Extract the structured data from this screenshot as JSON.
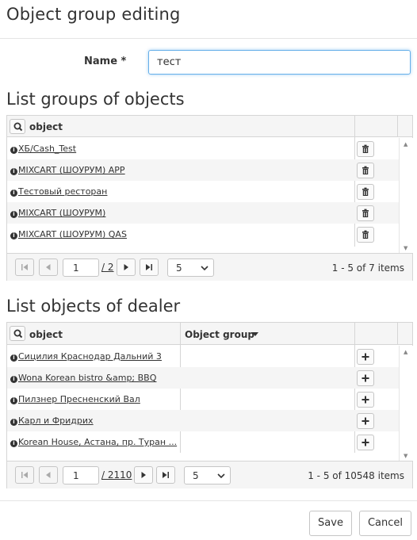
{
  "dialog": {
    "title": "Object group editing",
    "name_label": "Name *",
    "name_value": "тест"
  },
  "groups_list": {
    "title": "List groups of objects",
    "column_object": "object",
    "rows": [
      {
        "name": "ХБ/Cash_Test"
      },
      {
        "name": "MIXCART (ШОУРУМ) APP"
      },
      {
        "name": "Тестовый ресторан"
      },
      {
        "name": "MIXCART (ШОУРУМ)"
      },
      {
        "name": "MIXCART (ШОУРУМ) QAS"
      }
    ],
    "pager": {
      "page": "1",
      "of_pages": "/ 2",
      "page_size": "5",
      "summary": "1 - 5 of 7 items"
    }
  },
  "dealer_list": {
    "title": "List objects of dealer",
    "column_object": "object",
    "column_group": "Object group",
    "rows": [
      {
        "name": "Сицилия Краснодар Дальний 3",
        "group": ""
      },
      {
        "name": "Wona Korean bistro &amp; BBQ",
        "group": ""
      },
      {
        "name": "Пилзнер Пресненский Вал",
        "group": ""
      },
      {
        "name": "Карл и Фридрих",
        "group": ""
      },
      {
        "name": "Korean House, Астана, пр. Туран ...",
        "group": ""
      }
    ],
    "pager": {
      "page": "1",
      "of_pages": "/ 2110",
      "page_size": "5",
      "summary": "1 - 5 of 10548 items"
    }
  },
  "footer": {
    "save_label": "Save",
    "cancel_label": "Cancel"
  },
  "icons": {
    "search": "search-icon",
    "info": "info-icon",
    "trash": "trash-icon",
    "plus": "plus-icon",
    "sort": "sort-desc-icon"
  }
}
